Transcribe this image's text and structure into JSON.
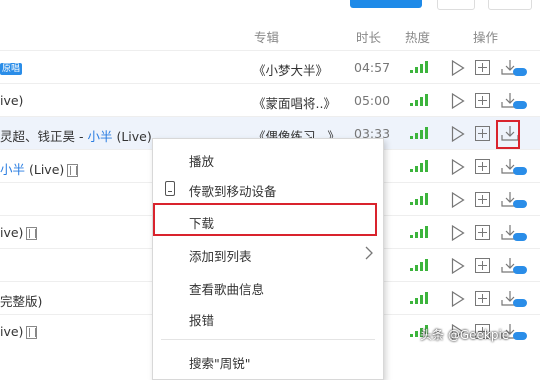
{
  "header": {
    "album": "专辑",
    "duration": "时长",
    "heat": "热度",
    "ops": "操作"
  },
  "rows": [
    {
      "title_pre": "",
      "title_highlight": "",
      "title_post": "",
      "tag": "原唱",
      "album": "《小梦大半》",
      "duration": "04:57"
    },
    {
      "title_pre": "ive)",
      "title_highlight": "",
      "title_post": "",
      "tag": "",
      "album": "《蒙面唱将..》",
      "duration": "05:00"
    },
    {
      "title_pre": "灵超、钱正昊 - ",
      "title_highlight": "小半",
      "title_post": " (Live)",
      "tag": "",
      "album": "《偶像练习...》",
      "duration": "03:33"
    },
    {
      "title_pre": "",
      "title_highlight": "小半",
      "title_post": " (Live)",
      "tag": "",
      "album": "",
      "duration": ""
    },
    {
      "title_pre": "",
      "title_highlight": "",
      "title_post": "",
      "tag": "",
      "album": "",
      "duration": ""
    },
    {
      "title_pre": "ive)",
      "title_highlight": "",
      "title_post": "",
      "tag": "",
      "album": "",
      "duration": ""
    },
    {
      "title_pre": "",
      "title_highlight": "",
      "title_post": "",
      "tag": "",
      "album": "",
      "duration": ""
    },
    {
      "title_pre": "完整版)",
      "title_highlight": "",
      "title_post": "",
      "tag": "",
      "album": "",
      "duration": ""
    },
    {
      "title_pre": "ive)",
      "title_highlight": "",
      "title_post": "",
      "tag": "",
      "album": "",
      "duration": ""
    }
  ],
  "menu": {
    "play": "播放",
    "transfer": "传歌到移动设备",
    "download": "下载",
    "add_to_list": "添加到列表",
    "song_info": "查看歌曲信息",
    "report": "报错",
    "search": "搜索\"周锐\""
  },
  "watermark": "头条 @Geekpie",
  "colors": {
    "accent": "#1e8ae8",
    "highlight": "#d9232d",
    "heat": "#3cb43c"
  }
}
